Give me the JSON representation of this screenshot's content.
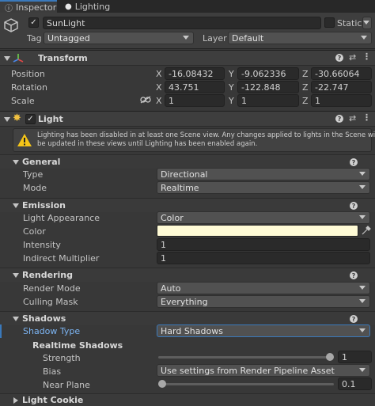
{
  "tabs": [
    {
      "label": "Inspector"
    },
    {
      "label": "Lighting"
    }
  ],
  "gameobject": {
    "name": "SunLight",
    "static_label": "Static",
    "tag_label": "Tag",
    "tag_value": "Untagged",
    "layer_label": "Layer",
    "layer_value": "Default"
  },
  "transform": {
    "title": "Transform",
    "position_label": "Position",
    "rotation_label": "Rotation",
    "scale_label": "Scale",
    "x_label": "X",
    "y_label": "Y",
    "z_label": "Z",
    "position": {
      "x": "-16.08432",
      "y": "-9.062336",
      "z": "-30.66064"
    },
    "rotation": {
      "x": "43.751",
      "y": "-122.848",
      "z": "-22.747"
    },
    "scale": {
      "x": "1",
      "y": "1",
      "z": "1"
    }
  },
  "light": {
    "title": "Light",
    "warning_line1": "Lighting has been disabled in at least one Scene view. Any changes applied to lights in the Scene will not",
    "warning_line2": "be updated in these views until Lighting has been enabled again.",
    "general": {
      "title": "General",
      "type_label": "Type",
      "type_value": "Directional",
      "mode_label": "Mode",
      "mode_value": "Realtime"
    },
    "emission": {
      "title": "Emission",
      "appearance_label": "Light Appearance",
      "appearance_value": "Color",
      "color_label": "Color",
      "color_value": "#fffbd6",
      "intensity_label": "Intensity",
      "intensity_value": "1",
      "indirect_label": "Indirect Multiplier",
      "indirect_value": "1"
    },
    "rendering": {
      "title": "Rendering",
      "render_mode_label": "Render Mode",
      "render_mode_value": "Auto",
      "culling_label": "Culling Mask",
      "culling_value": "Everything"
    },
    "shadows": {
      "title": "Shadows",
      "shadow_type_label": "Shadow Type",
      "shadow_type_value": "Hard Shadows",
      "realtime_title": "Realtime Shadows",
      "strength_label": "Strength",
      "strength_value": "1",
      "strength_fraction": 1.0,
      "bias_label": "Bias",
      "bias_value": "Use settings from Render Pipeline Asset",
      "near_plane_label": "Near Plane",
      "near_plane_value": "0.1",
      "near_plane_fraction": 0.0
    },
    "cookie_title": "Light Cookie"
  },
  "colors": {
    "accent": "#3a79bb",
    "highlight_label": "#7cb4f2",
    "warning": "#f5c518",
    "background": "#383838"
  }
}
